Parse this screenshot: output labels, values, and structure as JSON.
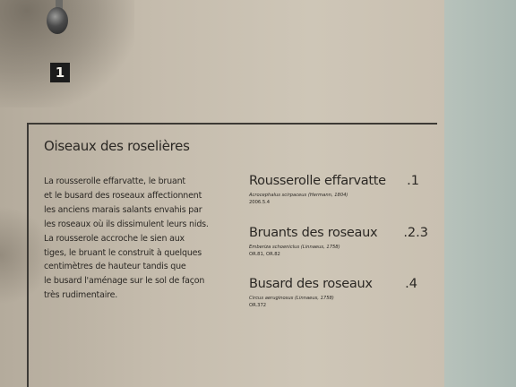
{
  "badge": "1",
  "title": "Oiseaux des roselières",
  "body_lines": [
    "La rousserolle effarvatte, le bruant",
    "et le busard des roseaux affectionnent",
    "les anciens marais salants envahis par",
    "les roseaux où ils dissimulent leurs nids.",
    "La rousserole accroche le sien aux",
    "tiges, le bruant le construit à quelques",
    "centimètres de hauteur tandis que",
    "le busard l'aménage sur le sol de façon",
    "très rudimentaire."
  ],
  "species": [
    {
      "name": "Rousserolle effarvatte",
      "latin": "Acrocephalus scirpaceus (Hermann, 1804)",
      "inventory": "2006.5.4",
      "ref": ".1"
    },
    {
      "name": "Bruants des roseaux",
      "latin": "Emberiza schoeniclus (Linnaeus, 1758)",
      "inventory": "OR.81, OR.82",
      "ref": ".2.3"
    },
    {
      "name": "Busard des roseaux",
      "latin": "Circus aeruginosus (Linnaeus, 1758)",
      "inventory": "OR.372",
      "ref": ".4"
    }
  ]
}
